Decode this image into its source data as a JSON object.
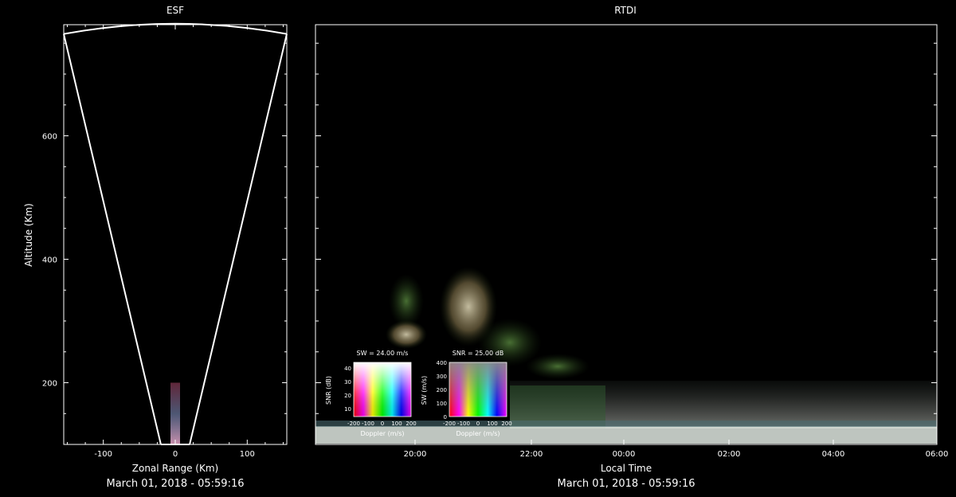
{
  "chart_data": [
    {
      "type": "scatter",
      "title": "ESF",
      "xlabel": "Zonal Range (Km)",
      "ylabel": "Altitude (Km)",
      "xlim": [
        -155,
        155
      ],
      "ylim": [
        100,
        780
      ],
      "x_ticks": [
        -100,
        0,
        100
      ],
      "y_ticks": [
        200,
        400,
        600
      ],
      "beam_edges": {
        "left": [
          [
            -155,
            765
          ],
          [
            -20,
            100
          ]
        ],
        "right": [
          [
            155,
            765
          ],
          [
            20,
            100
          ]
        ]
      },
      "echo": {
        "x": 0,
        "y_range": [
          100,
          200
        ]
      },
      "footer": "March 01, 2018 - 05:59:16"
    },
    {
      "type": "heatmap",
      "title": "RTDI",
      "xlabel": "Local Time",
      "x_ticks": [
        "20:00",
        "22:00",
        "00:00",
        "02:00",
        "04:00",
        "06:00"
      ],
      "ylim": [
        100,
        780
      ],
      "footer": "March 01, 2018 - 05:59:16",
      "legends": [
        {
          "title": "SW = 24.00 m/s",
          "xlabel": "Doppler (m/s)",
          "ylabel": "SNR (dB)",
          "x_ticks": [
            "-200",
            "-100",
            "0",
            "100",
            "200"
          ],
          "y_ticks": [
            "10",
            "20",
            "30",
            "40"
          ]
        },
        {
          "title": "SNR = 25.00 dB",
          "xlabel": "Doppler (m/s)",
          "ylabel": "SW (m/s)",
          "x_ticks": [
            "-200",
            "-100",
            "0",
            "100",
            "200"
          ],
          "y_ticks": [
            "0",
            "100",
            "200",
            "300",
            "400"
          ]
        }
      ]
    }
  ]
}
